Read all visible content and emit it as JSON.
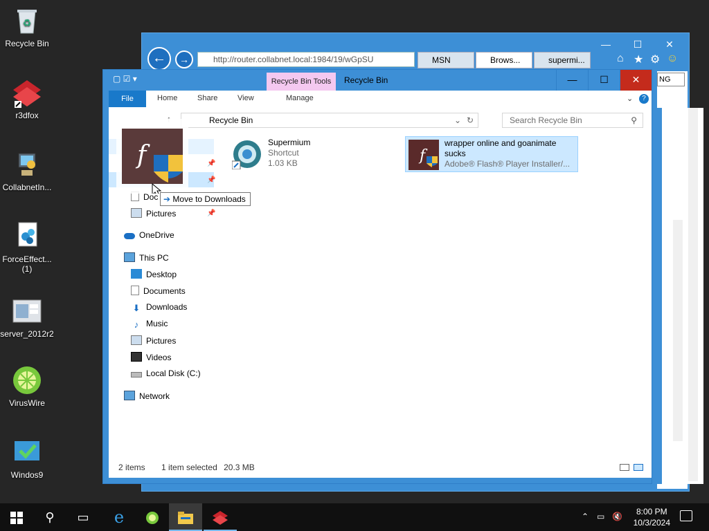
{
  "desktop": {
    "icons": [
      {
        "label": "Recycle Bin",
        "icon": "recycle-bin-icon"
      },
      {
        "label": "r3dfox",
        "icon": "r3dfox-icon"
      },
      {
        "label": "CollabnetIn...",
        "icon": "computer-icon"
      },
      {
        "label": "ForceEffect...",
        "label2": "(1)",
        "icon": "force-effect-icon"
      },
      {
        "label": "server_2012r2",
        "icon": "server-icon"
      },
      {
        "label": "VirusWire",
        "icon": "viruswire-icon"
      },
      {
        "label": "Windos9",
        "icon": "windos9-icon"
      }
    ]
  },
  "ie": {
    "address": "http://router.collabnet.local:1984/19/wGpSU",
    "tabs": [
      "MSN",
      "Brows...",
      "supermi..."
    ],
    "lang_fragment": "NG"
  },
  "explorer": {
    "context_tab": "Recycle Bin Tools",
    "title": "Recycle Bin",
    "ribbon": {
      "file": "File",
      "home": "Home",
      "share": "Share",
      "view": "View",
      "manage": "Manage"
    },
    "address_crumb": "Recycle Bin",
    "search_placeholder": "Search Recycle Bin",
    "nav": {
      "quick_docs_partial": "Doc",
      "quick_pictures": "Pictures",
      "onedrive": "OneDrive",
      "this_pc": "This PC",
      "desktop": "Desktop",
      "documents": "Documents",
      "downloads": "Downloads",
      "music": "Music",
      "pictures": "Pictures",
      "videos": "Videos",
      "local_disk": "Local Disk (C:)",
      "network": "Network"
    },
    "files": [
      {
        "name": "Supermium",
        "type": "Shortcut",
        "size": "1.03 KB"
      },
      {
        "name": "wrapper online and goanimate",
        "name2": "sucks",
        "type": "Adobe® Flash® Player Installer/..."
      }
    ],
    "status": {
      "items": "2 items",
      "selected": "1 item selected",
      "size": "20.3 MB"
    }
  },
  "drag": {
    "tooltip": "Move to Downloads"
  },
  "taskbar": {
    "time": "8:00 PM",
    "date": "10/3/2024"
  },
  "colors": {
    "accent": "#3d8fd6",
    "file_tab": "#1979ca",
    "context_tab": "#f4c8f0",
    "selection": "#cce8ff"
  }
}
